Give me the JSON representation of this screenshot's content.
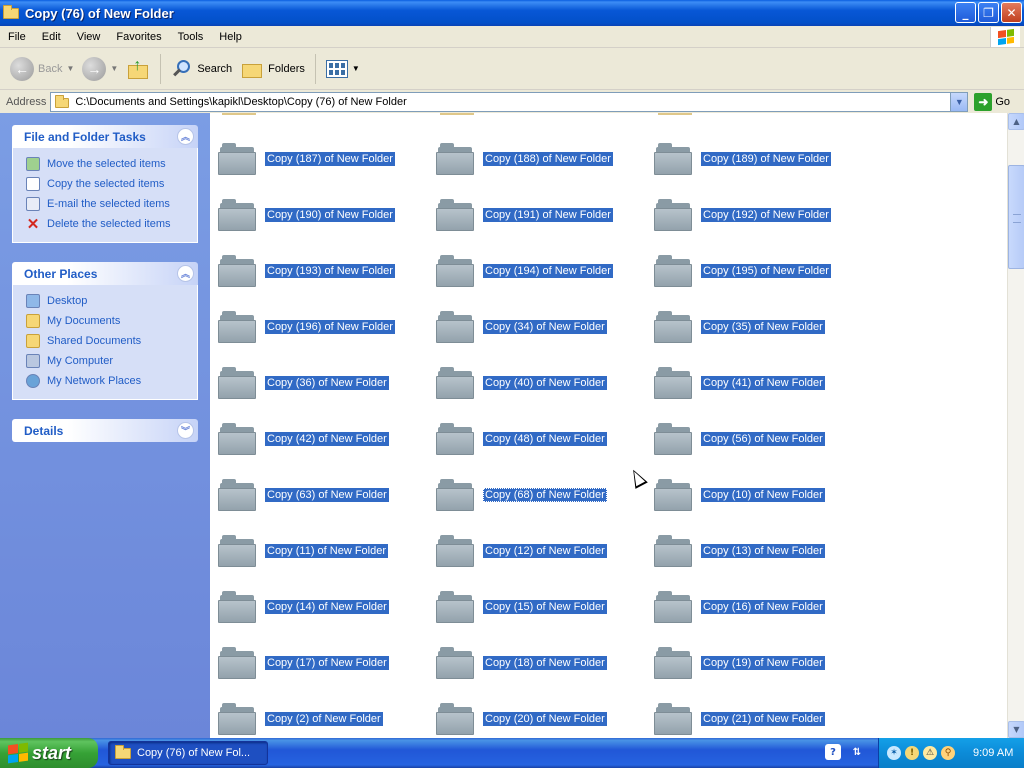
{
  "window": {
    "title": "Copy (76) of New Folder"
  },
  "menu": [
    "File",
    "Edit",
    "View",
    "Favorites",
    "Tools",
    "Help"
  ],
  "toolbar": {
    "back": "Back",
    "search": "Search",
    "folders": "Folders"
  },
  "address": {
    "label": "Address",
    "path": "C:\\Documents and Settings\\kapikl\\Desktop\\Copy (76) of New Folder",
    "go": "Go"
  },
  "taskpane": {
    "file_tasks": {
      "title": "File and Folder Tasks",
      "items": [
        "Move the selected items",
        "Copy the selected items",
        "E-mail the selected items",
        "Delete the selected items"
      ]
    },
    "other_places": {
      "title": "Other Places",
      "items": [
        "Desktop",
        "My Documents",
        "Shared Documents",
        "My Computer",
        "My Network Places"
      ]
    },
    "details": {
      "title": "Details"
    }
  },
  "folders": [
    "Copy (187) of New Folder",
    "Copy (188) of New Folder",
    "Copy (189) of New Folder",
    "Copy (190) of New Folder",
    "Copy (191) of New Folder",
    "Copy (192) of New Folder",
    "Copy (193) of New Folder",
    "Copy (194) of New Folder",
    "Copy (195) of New Folder",
    "Copy (196) of New Folder",
    "Copy (34) of New Folder",
    "Copy (35) of New Folder",
    "Copy (36) of New Folder",
    "Copy (40) of New Folder",
    "Copy (41) of New Folder",
    "Copy (42) of New Folder",
    "Copy (48) of New Folder",
    "Copy (56) of New Folder",
    "Copy (63) of New Folder",
    "Copy (68) of New Folder",
    "Copy (10) of New Folder",
    "Copy (11) of New Folder",
    "Copy (12) of New Folder",
    "Copy (13) of New Folder",
    "Copy (14) of New Folder",
    "Copy (15) of New Folder",
    "Copy (16) of New Folder",
    "Copy (17) of New Folder",
    "Copy (18) of New Folder",
    "Copy (19) of New Folder",
    "Copy (2) of New Folder",
    "Copy (20) of New Folder",
    "Copy (21) of New Folder"
  ],
  "focused_folder": "Copy (68) of New Folder",
  "taskbar": {
    "start": "start",
    "window_button": "Copy (76) of New Fol...",
    "clock": "9:09 AM"
  },
  "colors": {
    "selection": "#316AC5",
    "taskpane": "#7B9DE4",
    "titlebar": "#0250C9"
  }
}
